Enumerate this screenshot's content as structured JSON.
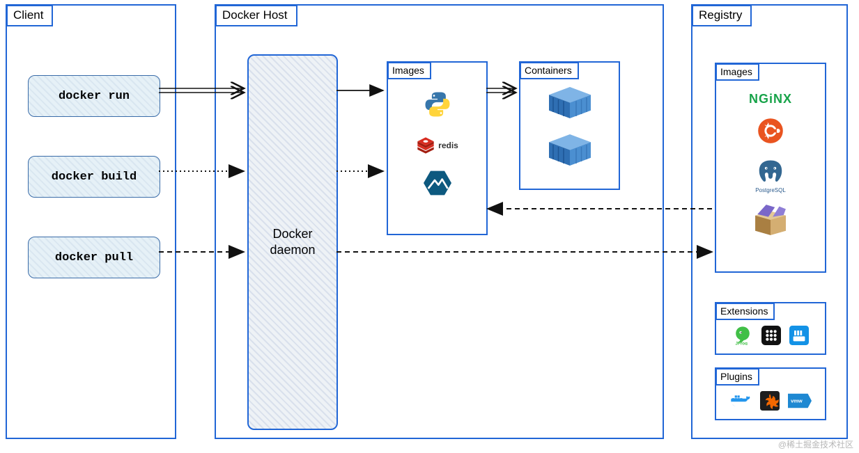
{
  "client": {
    "title": "Client",
    "cmds": {
      "run": "docker run",
      "build": "docker build",
      "pull": "docker pull"
    }
  },
  "host": {
    "title": "Docker Host",
    "daemon": "Docker\ndaemon",
    "images_title": "Images",
    "containers_title": "Containers",
    "images": [
      "python",
      "redis",
      "alpine"
    ],
    "containers": [
      "container-1",
      "container-2"
    ]
  },
  "registry": {
    "title": "Registry",
    "images_title": "Images",
    "extensions_title": "Extensions",
    "plugins_title": "Plugins",
    "images": [
      "nginx",
      "ubuntu",
      "postgresql",
      "box"
    ],
    "extensions": [
      "jfrog",
      "grid-app",
      "portainer"
    ],
    "plugins": [
      "docker",
      "grafana",
      "vmware"
    ],
    "nginx_label": "NGiNX",
    "redis_label": "redis",
    "postgres_label": "PostgreSQL"
  },
  "watermark": "@稀土掘金技术社区"
}
